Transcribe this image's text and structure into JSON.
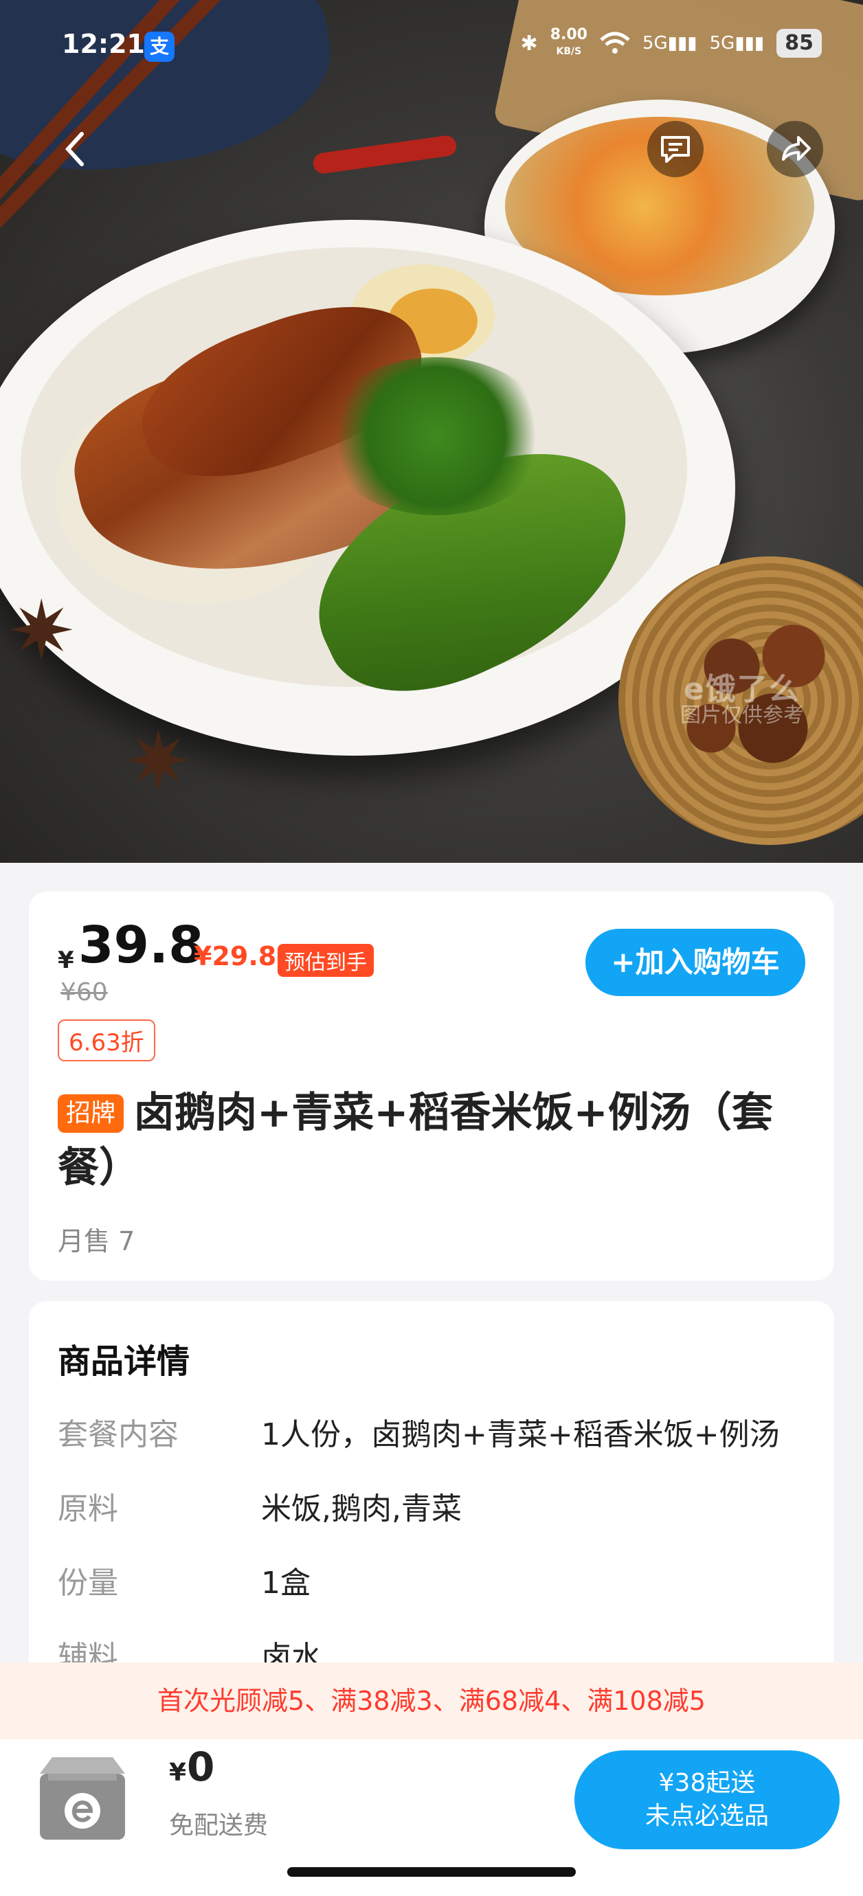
{
  "status_bar": {
    "time": "12:21",
    "alipay_icon_text": "支",
    "net_speed_value": "8.00",
    "net_speed_unit": "KB/S",
    "sim1": "5G",
    "sim2": "5G",
    "battery": "85"
  },
  "hero": {
    "watermark_brand": "e饿了么",
    "watermark_note": "图片仅供参考"
  },
  "product": {
    "currency": "¥",
    "price": "39.8",
    "est_price": "¥29.8",
    "est_label": "预估到手",
    "original_price": "¥60",
    "discount": "6.63折",
    "add_to_cart": "+加入购物车",
    "sign_badge": "招牌",
    "title": "卤鹅肉+青菜+稻香米饭+例汤（套餐）",
    "monthly_sales": "月售 7"
  },
  "details": {
    "section_title": "商品详情",
    "rows": [
      {
        "key": "套餐内容",
        "value": "1人份，卤鹅肉+青菜+稻香米饭+例汤"
      },
      {
        "key": "原料",
        "value": "米饭,鹅肉,青菜"
      },
      {
        "key": "份量",
        "value": "1盒"
      },
      {
        "key": "辅料",
        "value": "卤水"
      }
    ]
  },
  "promo": {
    "text": "首次光顾减5、满38减3、满68减4、满108减5"
  },
  "bottom": {
    "currency": "¥",
    "total": "0",
    "delivery": "免配送费",
    "checkout_line1": "¥38起送",
    "checkout_line2": "未点必选品"
  },
  "colors": {
    "accent_blue": "#12a5f5",
    "price_red": "#ff4a23",
    "badge_orange": "#ff6a0e",
    "promo_bg": "#fff2ea"
  }
}
